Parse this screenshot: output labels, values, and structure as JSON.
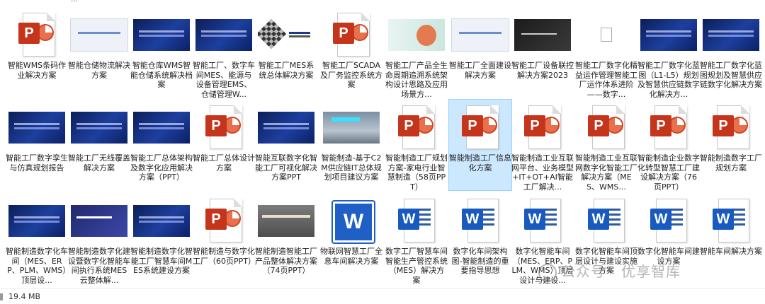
{
  "status_bar": {
    "size_text": "19.4 MB"
  },
  "watermark": {
    "text": "公众号 · 优享智库"
  },
  "rows": [
    [
      {
        "kind": "ppt",
        "label": "智能WMS条码作业解决方案"
      },
      {
        "kind": "thumb",
        "style": "t-light",
        "label": "智能仓储物流解决方案"
      },
      {
        "kind": "thumb",
        "style": "t-dark",
        "label": "智能仓库WMS智能仓储系统解决档案"
      },
      {
        "kind": "thumb",
        "style": "t-dark",
        "label": "智能工厂、数字车间MES、能源与设备管理EMS、仓储管理W..."
      },
      {
        "kind": "thumb",
        "style": "t-cube",
        "label": "智能工厂MES系统总体解决方案"
      },
      {
        "kind": "ppt",
        "label": "智能工厂SCADA及厂务监控系统方案"
      },
      {
        "kind": "thumb",
        "style": "t-teal",
        "label": "智能工厂产品全生命周期追溯系统架构设计思路及应用场景方..."
      },
      {
        "kind": "thumb",
        "style": "t-light",
        "label": "智能工厂全面建设解决方案"
      },
      {
        "kind": "thumb",
        "style": "t-darkgray",
        "label": "智能工厂设备联控解决方案2023"
      },
      {
        "kind": "blank",
        "label": "智能工厂数字化精益运作管理智能工厂运作体系进阶——数字..."
      },
      {
        "kind": "thumb",
        "style": "t-dark",
        "label": "智能工厂数字化蓝图（L1-L5）规划及智慧供应链数字化解决方..."
      },
      {
        "kind": "thumb",
        "style": "t-dark",
        "label": "智能工厂数字化蓝图规划及智慧供应链数字化解决方案"
      }
    ],
    [
      {
        "kind": "thumb",
        "style": "t-dark",
        "label": "智能工厂数字孪生与仿真规划报告"
      },
      {
        "kind": "thumb",
        "style": "t-dark",
        "label": "智能工厂无线覆盖解决方案"
      },
      {
        "kind": "thumb",
        "style": "t-dark",
        "label": "智能工厂总体架构及数字化应用解决方案（PPT）"
      },
      {
        "kind": "ppt",
        "label": "智能工厂总体设计方案"
      },
      {
        "kind": "thumb",
        "style": "t-dark",
        "label": "智能互联数字化智能工厂可视化解决方案PPT"
      },
      {
        "kind": "thumb",
        "style": "t-photo",
        "label": "智能制造-基于C2M供应链IT总体规划项目建议方案"
      },
      {
        "kind": "ppt",
        "label": "智能制造工厂规划方案-家电行业智慧制造（58页PPT）"
      },
      {
        "kind": "ppt",
        "label": "智能制造工厂信息化方案",
        "selected": true
      },
      {
        "kind": "ppt",
        "label": "智能制造工业互联网平台、业务模型+IT+OT+AI智能工厂解决..."
      },
      {
        "kind": "ppt",
        "label": "智能制造工业互联网数字化智能工厂解决方案（MES、WMS..."
      },
      {
        "kind": "ppt",
        "label": "智能制造企业数字化转型智慧工厂建设解决方案（76页PPT）"
      },
      {
        "kind": "ppt",
        "label": "智能制造数字工厂规划方案"
      }
    ],
    [
      {
        "kind": "thumb",
        "style": "t-dark",
        "label": "智能制造数字化车间（MES、ERP、PLM、WMS）顶层设..."
      },
      {
        "kind": "thumb",
        "style": "t-navy",
        "label": "智能制造数字化建设暨数字化智能车间执行系统MES云整体解..."
      },
      {
        "kind": "thumb",
        "style": "t-dark",
        "label": "智能制造数字化智能工厂智慧车间MES系统建设方案"
      },
      {
        "kind": "ppt",
        "label": "智能制造与数字化工厂（60页PPT）"
      },
      {
        "kind": "thumb",
        "style": "t-gray",
        "label": "智能制造智能工厂产品整体解决方案（74页PPT）"
      },
      {
        "kind": "wordbig",
        "label": "物联网智慧工厂全息车间解决方案"
      },
      {
        "kind": "doc",
        "label": "数字工厂智慧车间智能生产管控系统（MES）解决方案"
      },
      {
        "kind": "doc",
        "label": "数字化车间架构图-智能制造的重要指导思想"
      },
      {
        "kind": "doc",
        "label": "数字化智能车间（MES、ERP、PLM、WMS）顶层设计与建设..."
      },
      {
        "kind": "doc",
        "label": "数字化智能车间顶层设计与建设实施方案"
      },
      {
        "kind": "doc",
        "label": "数字化智能车间建设方案"
      },
      {
        "kind": "doc",
        "label": "智能车间解决方案"
      }
    ]
  ]
}
